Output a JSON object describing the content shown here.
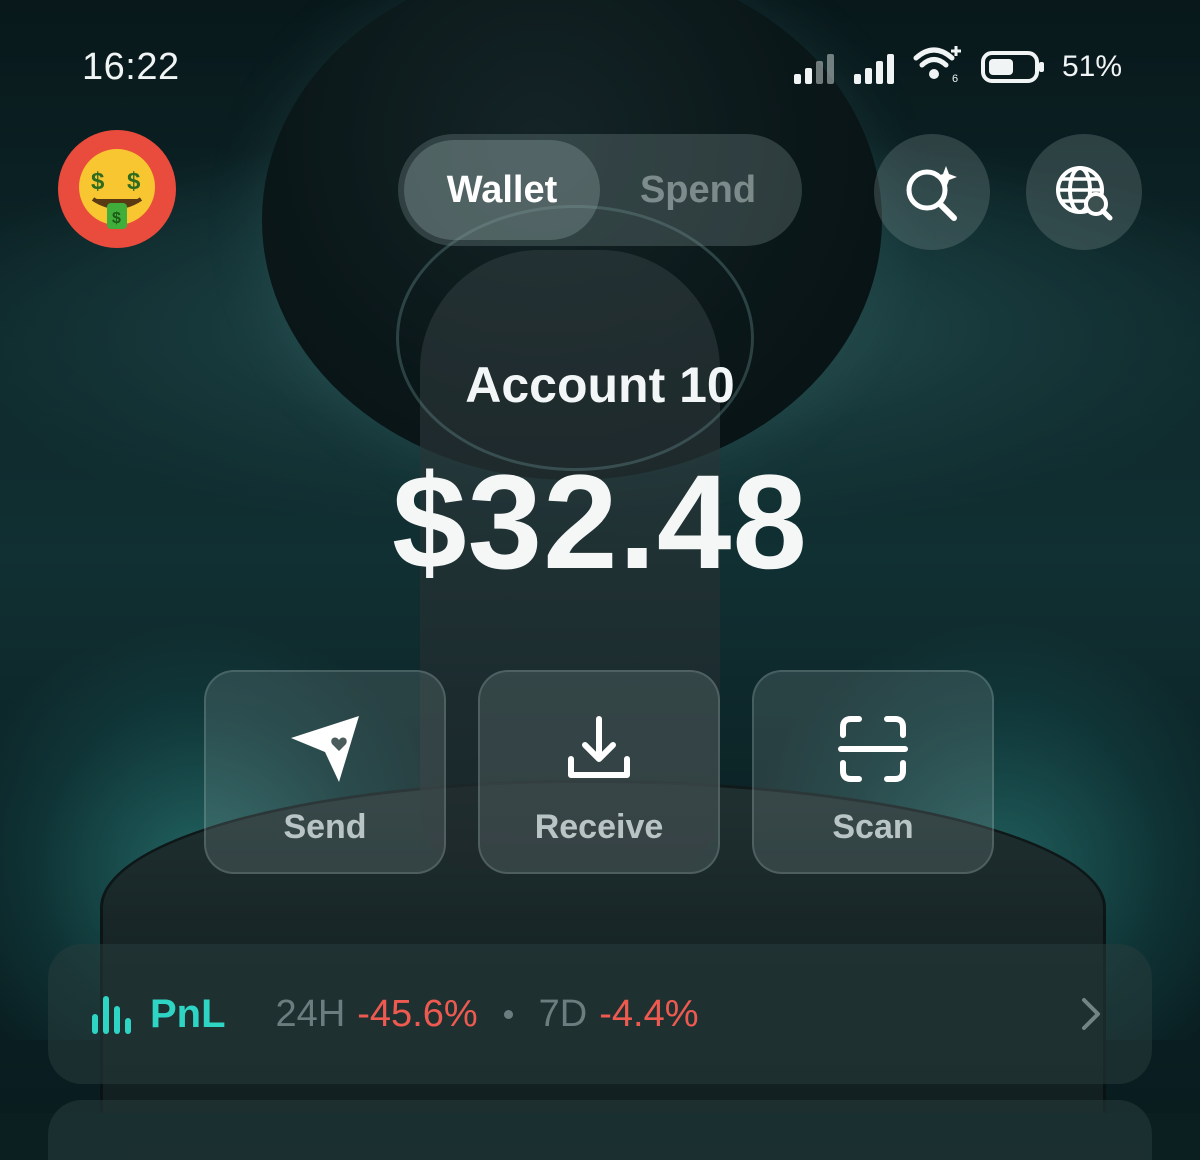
{
  "status_bar": {
    "time": "16:22",
    "battery_percent": "51%",
    "icons": [
      "signal-bars-icon",
      "signal-bars-icon",
      "wifi-icon",
      "battery-icon"
    ]
  },
  "header": {
    "avatar_icon": "money-mouth-face-icon",
    "tabs": [
      {
        "label": "Wallet",
        "active": true
      },
      {
        "label": "Spend",
        "active": false
      }
    ],
    "icons": [
      "search-sparkle-icon",
      "globe-search-icon"
    ]
  },
  "account": {
    "name": "Account 10",
    "balance": "$32.48"
  },
  "actions": [
    {
      "label": "Send",
      "icon": "send-heart-icon"
    },
    {
      "label": "Receive",
      "icon": "download-tray-icon"
    },
    {
      "label": "Scan",
      "icon": "scan-frame-icon"
    }
  ],
  "pnl": {
    "title": "PnL",
    "period_24h_label": "24H",
    "period_24h_value": "-45.6%",
    "period_7d_label": "7D",
    "period_7d_value": "-4.4%",
    "colors": {
      "accent": "#2fd5c4",
      "negative": "#ef5a50"
    }
  }
}
